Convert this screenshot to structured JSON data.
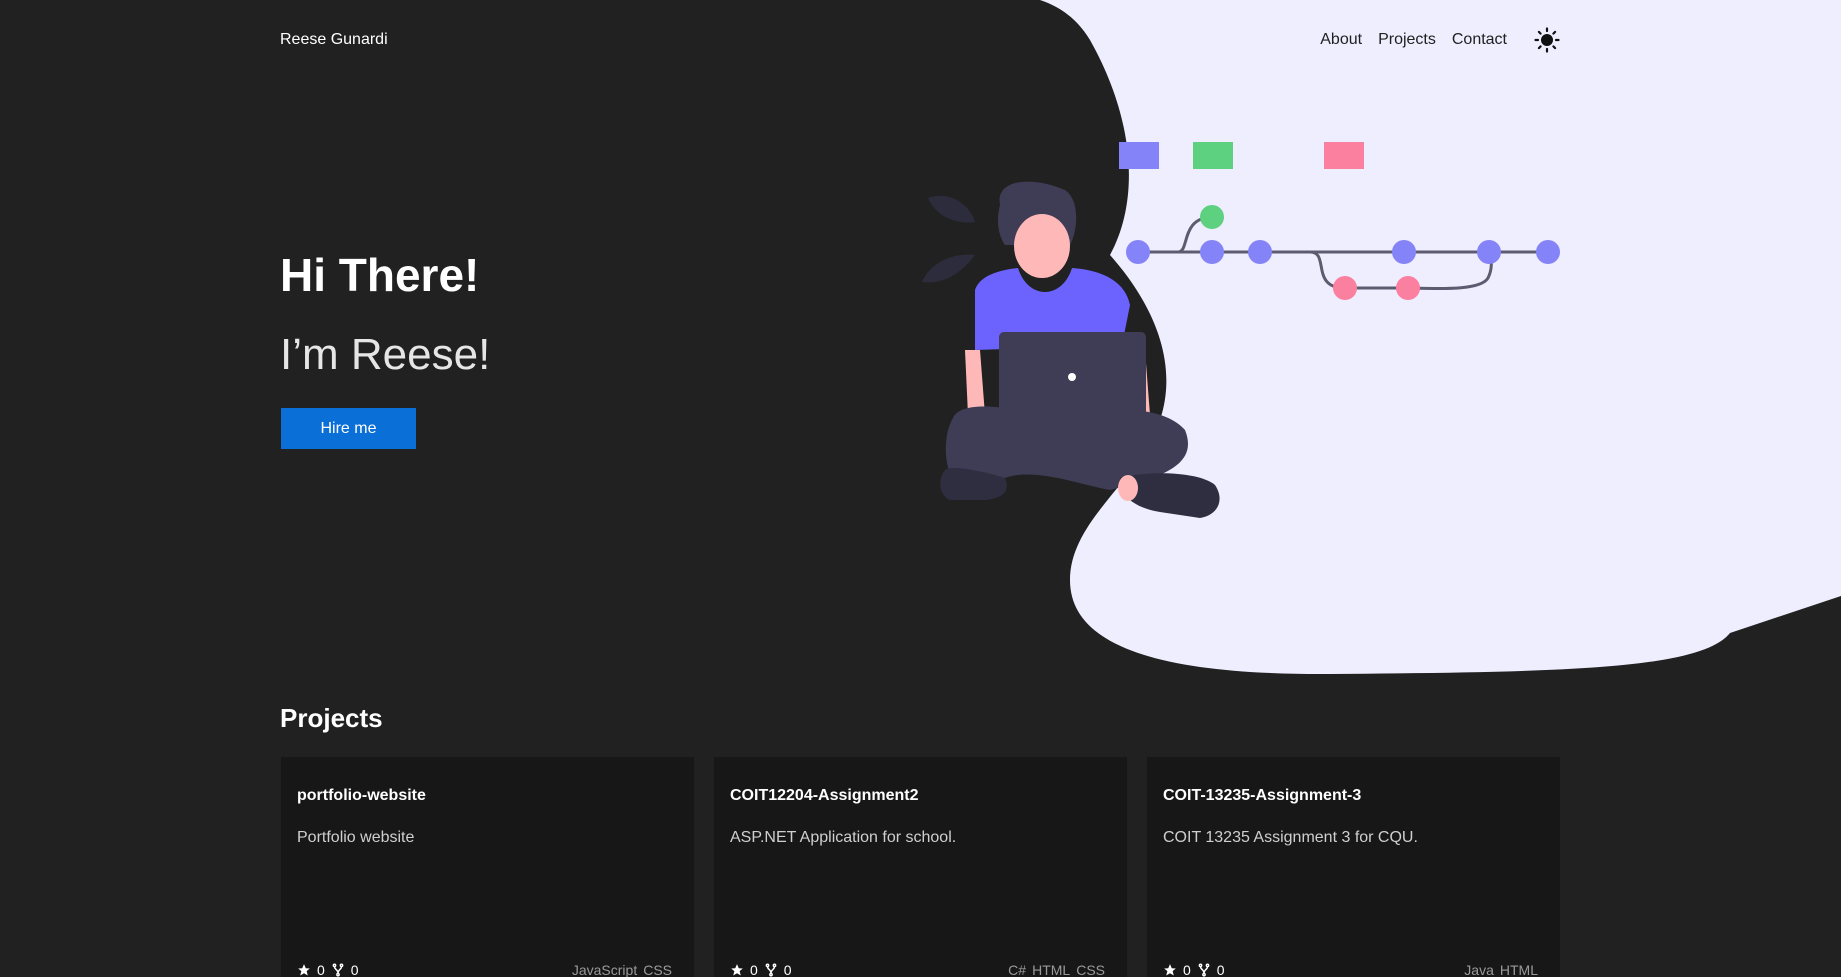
{
  "nav": {
    "brand": "Reese Gunardi",
    "links": [
      "About",
      "Projects",
      "Contact"
    ],
    "theme_icon": "sun-icon"
  },
  "hero": {
    "title": "Hi There!",
    "subtitle": "I’m Reese!",
    "button_label": "Hire me"
  },
  "projects": {
    "heading": "Projects",
    "cards": [
      {
        "title": "portfolio-website",
        "description": "Portfolio website",
        "stars": "0",
        "forks": "0",
        "langs": [
          "JavaScript",
          "CSS"
        ]
      },
      {
        "title": "COIT12204-Assignment2",
        "description": "ASP.NET Application for school.",
        "stars": "0",
        "forks": "0",
        "langs": [
          "C#",
          "HTML",
          "CSS"
        ]
      },
      {
        "title": "COIT-13235-Assignment-3",
        "description": "COIT 13235 Assignment 3 for CQU.",
        "stars": "0",
        "forks": "0",
        "langs": [
          "Java",
          "HTML"
        ]
      }
    ]
  },
  "colors": {
    "background": "#212121",
    "blob": "#efeefe",
    "accent": "#0a6fd6",
    "card": "#171717",
    "purple": "#8583f8",
    "green": "#5dd17f",
    "pink": "#fb7f9e"
  }
}
